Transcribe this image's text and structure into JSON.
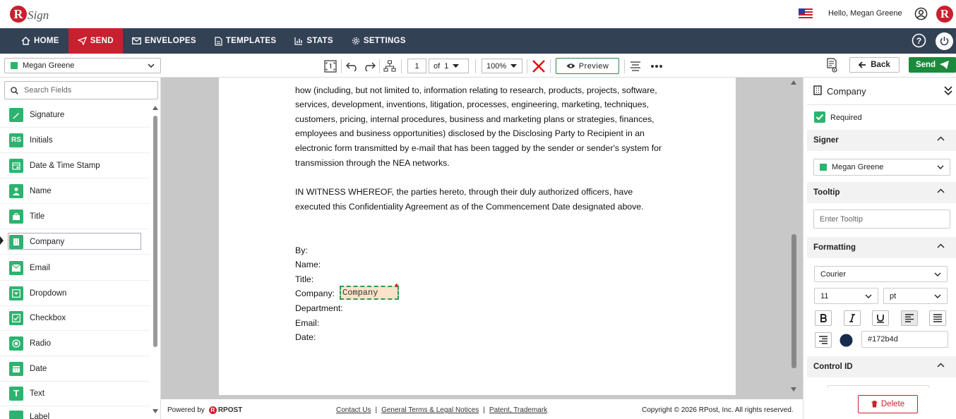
{
  "app": {
    "logo_text": "Sign",
    "greeting": "Hello, Megan Greene",
    "avatar_letter": "R"
  },
  "nav": {
    "items": [
      {
        "label": "HOME",
        "icon": "home-icon"
      },
      {
        "label": "SEND",
        "icon": "send-icon",
        "active": true
      },
      {
        "label": "ENVELOPES",
        "icon": "envelope-icon"
      },
      {
        "label": "TEMPLATES",
        "icon": "template-icon"
      },
      {
        "label": "STATS",
        "icon": "stats-icon"
      },
      {
        "label": "SETTINGS",
        "icon": "gear-icon"
      }
    ]
  },
  "toolbar": {
    "signer": "Megan Greene",
    "page_current": "1",
    "page_of_label": "of",
    "page_total": "1",
    "zoom": "100%",
    "preview_label": "Preview",
    "back_label": "Back",
    "send_label": "Send"
  },
  "left_panel": {
    "search_placeholder": "Search Fields",
    "fields": [
      {
        "label": "Signature",
        "icon": "pen-icon"
      },
      {
        "label": "Initials",
        "icon": "initials-icon",
        "glyph": "RS"
      },
      {
        "label": "Date & Time Stamp",
        "icon": "calendar-clock-icon"
      },
      {
        "label": "Name",
        "icon": "person-icon"
      },
      {
        "label": "Title",
        "icon": "briefcase-icon"
      },
      {
        "label": "Company",
        "icon": "building-icon",
        "selected": true
      },
      {
        "label": "Email",
        "icon": "mail-icon"
      },
      {
        "label": "Dropdown",
        "icon": "dropdown-icon"
      },
      {
        "label": "Checkbox",
        "icon": "checkbox-icon"
      },
      {
        "label": "Radio",
        "icon": "radio-icon"
      },
      {
        "label": "Date",
        "icon": "calendar-icon"
      },
      {
        "label": "Text",
        "icon": "text-icon",
        "glyph": "T"
      },
      {
        "label": "Label",
        "icon": "label-icon"
      }
    ]
  },
  "document": {
    "lines": [
      "how (including, but not limited to, information relating to research, products, projects, software,",
      "services, development, inventions, litigation, processes, engineering, marketing, techniques,",
      "customers, pricing, internal procedures, business and marketing plans or strategies, finances,",
      "employees and business opportunities) disclosed by the Disclosing Party to Recipient in an",
      "electronic form transmitted by e-mail that has been tagged by the sender or sender's system for",
      "transmission through the NEA networks.",
      "IN WITNESS WHEREOF, the parties hereto, through their duly authorized officers, have",
      "executed this Confidentiality Agreement as of the Commencement Date designated above.",
      "By:",
      "Name:",
      "Title:",
      "Company:",
      "Department:",
      "Email:",
      "Date:"
    ],
    "placed_field_text": "Company",
    "required_marker": "*"
  },
  "footer": {
    "powered_by": "Powered by",
    "brand": "RPOST",
    "links": [
      "Contact Us",
      "General Terms & Legal Notices",
      "Patent, Trademark"
    ],
    "separator": "|",
    "copyright": "Copyright © 2026 RPost, Inc. All rights reserved."
  },
  "right_panel": {
    "title": "Company",
    "required_label": "Required",
    "required_checked": true,
    "signer_header": "Signer",
    "signer_value": "Megan Greene",
    "tooltip_header": "Tooltip",
    "tooltip_placeholder": "Enter Tooltip",
    "formatting_header": "Formatting",
    "font": "Courier",
    "font_size": "11",
    "font_unit": "pt",
    "color_hex": "#172b4d",
    "control_id_header": "Control ID",
    "delete_label": "Delete"
  },
  "colors": {
    "brand_red": "#c8202f",
    "nav_bg": "#334155",
    "accent_green": "#2db36f",
    "send_green": "#1c8a3c",
    "field_fill": "#fbe2c8",
    "text_color": "#172b4d"
  }
}
